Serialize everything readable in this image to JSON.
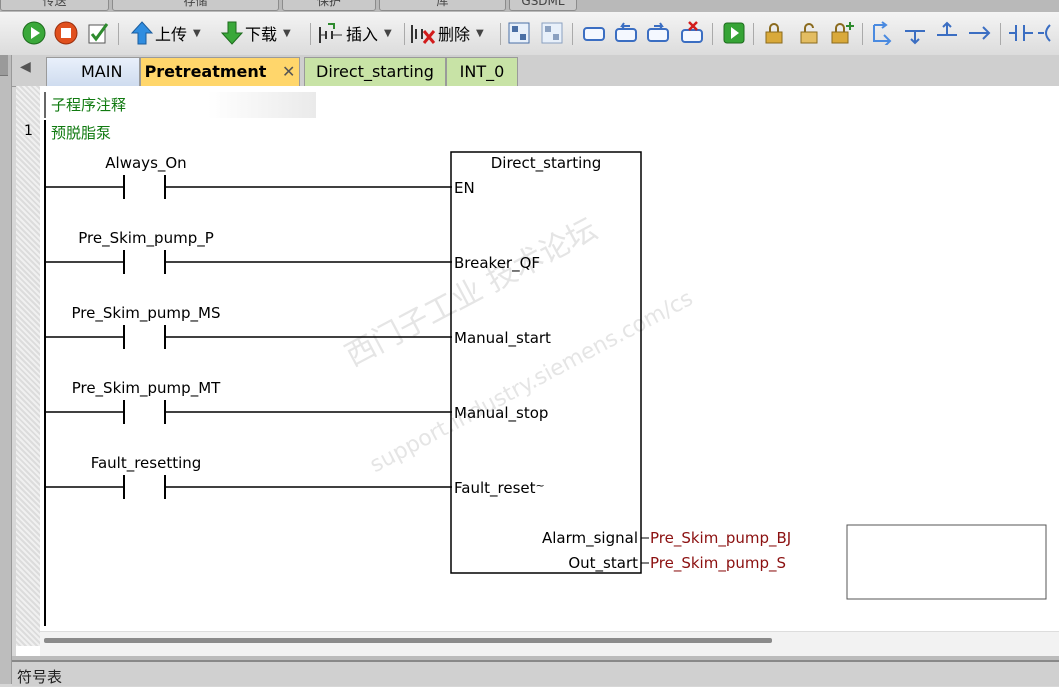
{
  "top_tabs": [
    "传送",
    "存储",
    "保护",
    "库",
    "GSDML"
  ],
  "toolbar": {
    "upload_label": "上传",
    "download_label": "下载",
    "insert_label": "插入",
    "delete_label": "删除"
  },
  "tabs": [
    "MAIN",
    "Pretreatment",
    "Direct_starting",
    "INT_0"
  ],
  "tab_close": "✕",
  "editor": {
    "subroutine_comment": "子程序注释",
    "network_number": "1",
    "network_title": "预脱脂泵"
  },
  "block": {
    "name": "Direct_starting",
    "inputs": [
      "EN",
      "Breaker_QF",
      "Manual_start",
      "Manual_stop",
      "Fault_reset"
    ],
    "fault_reset_suffix": "~",
    "outputs": [
      "Alarm_signal",
      "Out_start"
    ],
    "output_vars": [
      "Pre_Skim_pump_BJ",
      "Pre_Skim_pump_S"
    ]
  },
  "contacts": [
    "Always_On",
    "Pre_Skim_pump_P",
    "Pre_Skim_pump_MS",
    "Pre_Skim_pump_MT",
    "Fault_resetting"
  ],
  "watermark": [
    "西门子工业 技术论坛",
    "support.industry.siemens.com/cs"
  ],
  "status": {
    "symbol_table": "符号表"
  },
  "colors": {
    "tab_active": "#ffd66b",
    "tab_green": "#c8e3a6",
    "comment_green": "#107a10",
    "var_red": "#8b1010"
  }
}
